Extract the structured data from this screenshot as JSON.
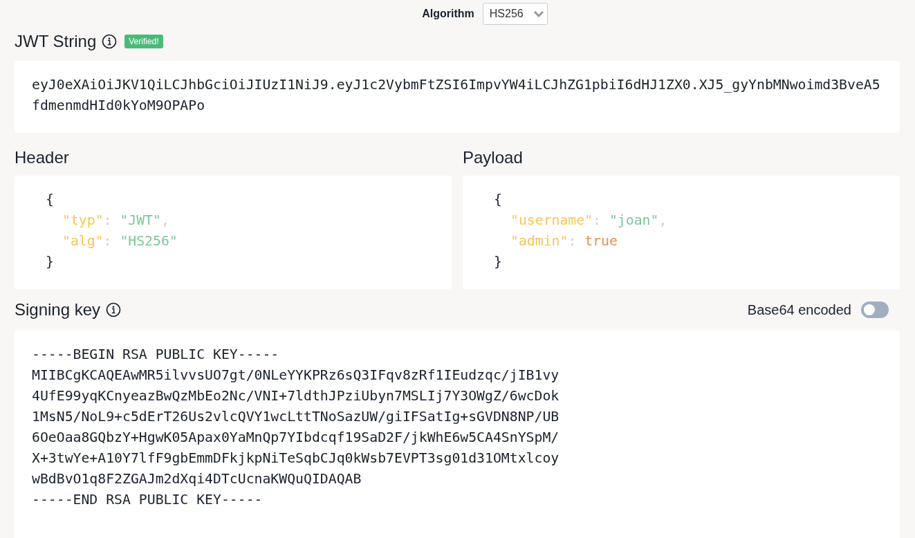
{
  "algorithm": {
    "label": "Algorithm",
    "value": "HS256"
  },
  "jwt": {
    "title": "JWT String",
    "badge": "Verified!",
    "verified": true,
    "token": "eyJ0eXAiOiJKV1QiLCJhbGciOiJIUzI1NiJ9.eyJ1c2VybmFtZSI6ImpvYW4iLCJhZG1pbiI6dHJ1ZX0.XJ5_gyYnbMNwoimd3BveA5fdmenmdHId0kYoM9OPAPo"
  },
  "panels": [
    {
      "title": "Header",
      "open": "{",
      "close": "}",
      "entries": [
        {
          "key": "\"typ\"",
          "sep": ":",
          "value": "\"JWT\"",
          "kind": "string",
          "comma": ","
        },
        {
          "key": "\"alg\"",
          "sep": ":",
          "value": "\"HS256\"",
          "kind": "string"
        }
      ]
    },
    {
      "title": "Payload",
      "open": "{",
      "close": "}",
      "entries": [
        {
          "key": "\"username\"",
          "sep": ":",
          "value": "\"joan\"",
          "kind": "string",
          "comma": ","
        },
        {
          "key": "\"admin\"",
          "sep": ":",
          "value": "true",
          "kind": "boolean"
        }
      ]
    }
  ],
  "signing_key": {
    "title": "Signing key",
    "base64_label": "Base64 encoded",
    "base64_on": false,
    "lines": [
      "-----BEGIN RSA PUBLIC KEY-----",
      "MIIBCgKCAQEAwMR5ilvvsUO7gt/0NLeYYKPRz6sQ3IFqv8zRf1IEudzqc/jIB1vy",
      "4UfE99yqKCnyeazBwQzMbEo2Nc/VNI+7ldthJPziUbyn7MSLIj7Y3OWgZ/6wcDok",
      "1MsN5/NoL9+c5dErT26Us2vlcQVY1wcLttTNoSazUW/giIFSatIg+sGVDN8NP/UB",
      "6OeOaa8GQbzY+HgwK05Apax0YaMnQp7YIbdcqf19SaD2F/jkWhE6w5CA4SnYSpM/",
      "X+3twYe+A10Y7lfF9gbEmmDFkjkpNiTeSqbCJq0kWsb7EVPT3sg01d31OMtxlcoy",
      "wBdBvO1q8F2ZGAJm2dXqi4DTcUcnaKWQuQIDAQAB",
      "-----END RSA PUBLIC KEY-----"
    ]
  }
}
